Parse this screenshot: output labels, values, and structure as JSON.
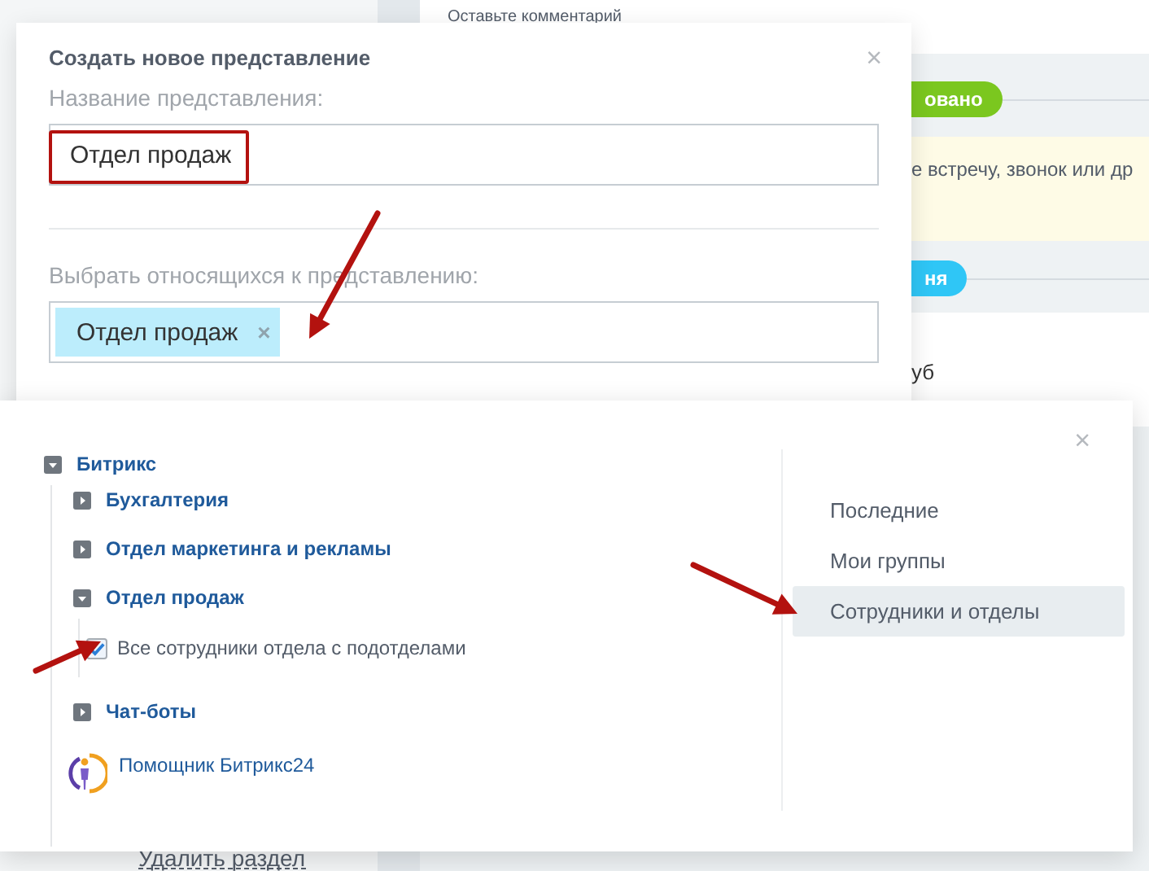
{
  "page": {
    "comment_hint": "Оставьте комментарий",
    "green_badge": " овано",
    "notice": "е встречу, звонок или др",
    "blue_badge": "ня",
    "text_fragment": "уб",
    "delete_link": "Удалить раздел"
  },
  "dialog": {
    "title": "Создать новое представление",
    "close": "×",
    "name_label": "Название представления:",
    "name_value": "Отдел продаж",
    "members_label": "Выбрать относящихся к представлению:",
    "tags": [
      {
        "label": "Отдел продаж",
        "remove": "×"
      }
    ]
  },
  "selector": {
    "close": "×",
    "tree": [
      {
        "kind": "group",
        "label": "Битрикс",
        "expanded": true,
        "children": [
          {
            "kind": "group",
            "label": "Бухгалтерия",
            "expanded": false
          },
          {
            "kind": "group",
            "label": "Отдел маркетинга и рекламы",
            "expanded": false
          },
          {
            "kind": "group",
            "label": "Отдел продаж",
            "expanded": true,
            "children": [
              {
                "kind": "option",
                "label": "Все сотрудники отдела с подотделами",
                "checked": true
              }
            ]
          },
          {
            "kind": "group",
            "label": "Чат-боты",
            "expanded": false
          },
          {
            "kind": "user",
            "label": "Помощник Битрикс24"
          }
        ]
      }
    ],
    "tabs": [
      {
        "label": "Последние",
        "selected": false
      },
      {
        "label": "Мои группы",
        "selected": false
      },
      {
        "label": "Сотрудники и отделы",
        "selected": true
      }
    ]
  }
}
